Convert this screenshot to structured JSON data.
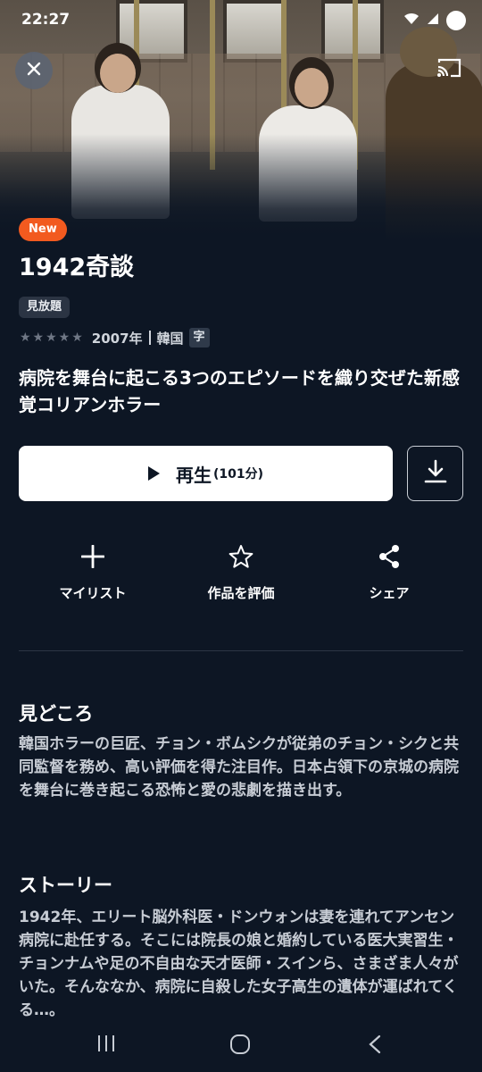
{
  "status_bar": {
    "time": "22:27"
  },
  "badge_new": "New",
  "title": "1942奇談",
  "plan_badge": "見放題",
  "meta": {
    "year": "2007年",
    "country": "韓国",
    "subtitle_badge": "字"
  },
  "catchphrase": "病院を舞台に起こる3つのエピソードを織り交ぜた新感覚コリアンホラー",
  "play": {
    "label": "再生",
    "duration": "(101分)"
  },
  "actions": {
    "mylist": "マイリスト",
    "rate": "作品を評価",
    "share": "シェア"
  },
  "highlights": {
    "heading": "見どころ",
    "text": "韓国ホラーの巨匠、チョン・ボムシクが従弟のチョン・シクと共同監督を務め、高い評価を得た注目作。日本占領下の京城の病院を舞台に巻き起こる恐怖と愛の悲劇を描き出す。"
  },
  "story": {
    "heading": "ストーリー",
    "text": "1942年、エリート脳外科医・ドンウォンは妻を連れてアンセン病院に赴任する。そこには院長の娘と婚約している医大実習生・チョンナムや足の不自由な天才医師・スインら、さまざま人々がいた。そんななか、病院に自殺した女子高生の遺体が運ばれてくる…。"
  },
  "colors": {
    "background": "#0d1624",
    "new_badge": "#f25a1f",
    "button": "#ffffff"
  }
}
